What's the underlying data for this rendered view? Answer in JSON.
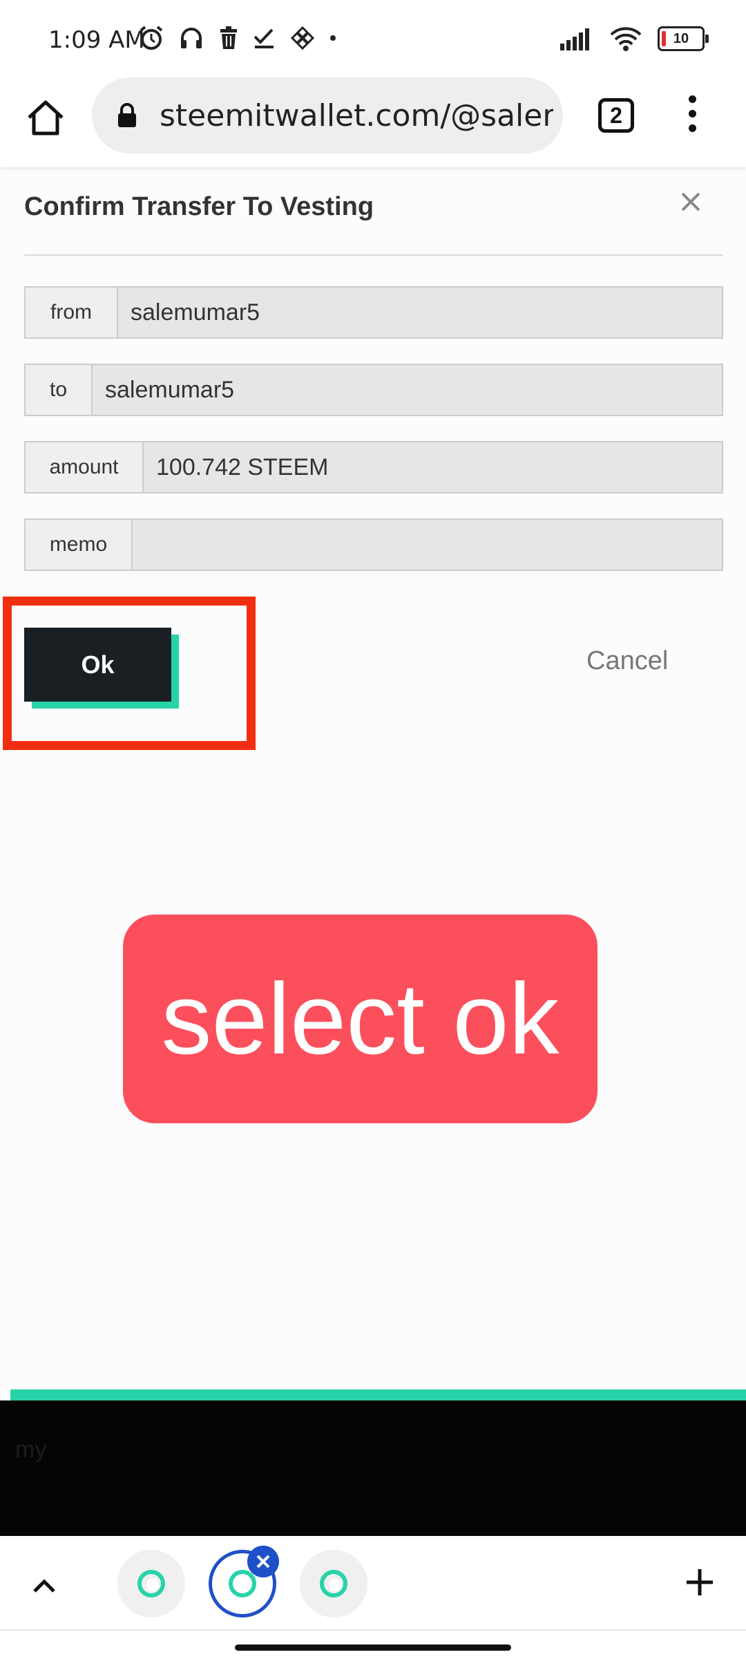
{
  "status_bar": {
    "time": "1:09 AM",
    "battery_level": "10",
    "icons": [
      "alarm-icon",
      "headphones-icon",
      "trash-icon",
      "check-icon",
      "binance-icon",
      "dot-icon",
      "signal-icon",
      "wifi-icon",
      "battery-icon"
    ]
  },
  "browser": {
    "url": "steemitwallet.com/@salemu",
    "tab_count": "2"
  },
  "modal": {
    "title": "Confirm Transfer To Vesting",
    "fields": [
      {
        "label": "from",
        "value": "salemumar5"
      },
      {
        "label": "to",
        "value": "salemumar5"
      },
      {
        "label": "amount",
        "value": "100.742 STEEM"
      },
      {
        "label": "memo",
        "value": ""
      }
    ],
    "ok_label": "Ok",
    "cancel_label": "Cancel"
  },
  "annotation": {
    "callout_text": "select ok",
    "highlight_color": "#f22e12",
    "callout_color": "#fb4f5c"
  },
  "colors": {
    "accent": "#27d3a8",
    "button_dark": "#1a1f24",
    "active_tab_ring": "#1e50c8"
  },
  "footer": {
    "faint_text": "my"
  }
}
